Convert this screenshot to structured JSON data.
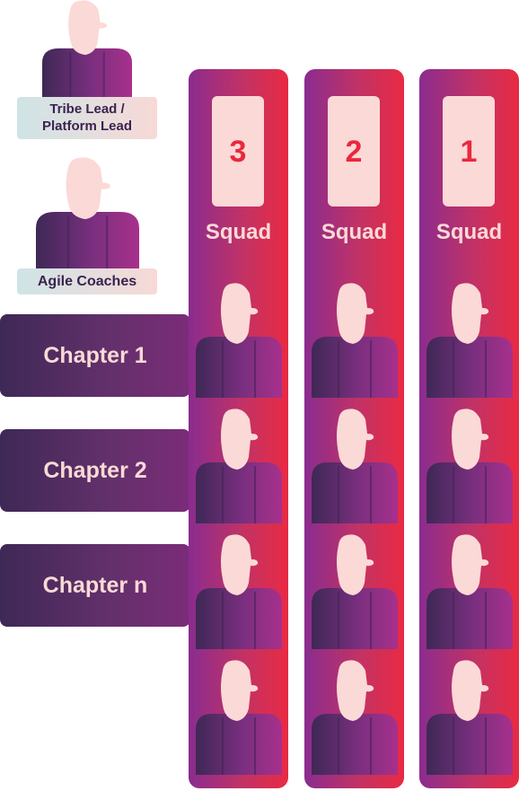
{
  "leaders": {
    "tribe_lead": "Tribe Lead / Platform Lead",
    "tribe_lead_line1": "Tribe Lead /",
    "tribe_lead_line2": "Platform Lead",
    "agile_coaches": "Agile Coaches"
  },
  "squads": [
    {
      "number": "3",
      "label": "Squad"
    },
    {
      "number": "2",
      "label": "Squad"
    },
    {
      "number": "1",
      "label": "Squad"
    }
  ],
  "chapters": [
    {
      "label": "Chapter 1"
    },
    {
      "label": "Chapter 2"
    },
    {
      "label": "Chapter n"
    }
  ],
  "members_per_squad": 4,
  "icons": {
    "person": "person-icon"
  },
  "colors": {
    "squad_gradient_start": "#8a2c8f",
    "squad_gradient_end": "#e92a43",
    "chapter_dark": "#3e2856",
    "skin": "#fbd9d6",
    "shirt_dark": "#3e2856",
    "shirt_light": "#9a2f8c",
    "label_bg": "#d7e6ea"
  }
}
